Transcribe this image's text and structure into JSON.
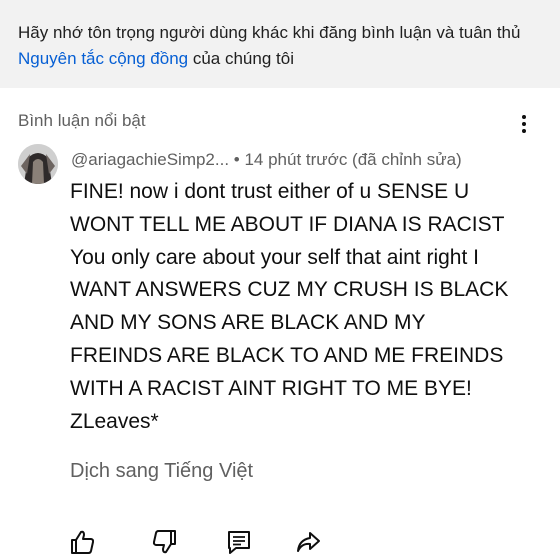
{
  "notice": {
    "before": "Hãy nhớ tôn trọng người dùng khác khi đăng bình luận và tuân thủ ",
    "link": "Nguyên tắc cộng đồng",
    "after": " của chúng tôi"
  },
  "section": {
    "title": "Bình luận nổi bật"
  },
  "comment": {
    "author": "@ariagachieSimp2...",
    "meta": " • 14 phút trước (đã chỉnh sửa)",
    "lines": [
      "FINE! now i dont trust either of u SENSE U",
      "WONT TELL ME ABOUT IF DIANA IS RACIST",
      "You only care about your self that aint right I",
      "WANT ANSWERS CUZ MY CRUSH IS BLACK",
      "AND MY SONS ARE BLACK AND MY",
      "FREINDS ARE BLACK TO  AND ME FREINDS",
      "WITH A RACIST AINT RIGHT TO ME BYE!",
      "ZLeaves*"
    ],
    "translate": "Dịch sang Tiếng Việt"
  },
  "icons": [
    "like-icon",
    "dislike-icon",
    "reply-icon",
    "share-icon"
  ],
  "colors": {
    "link": "#065fd4",
    "secondary_text": "#606060",
    "notice_bg": "#f2f2f2"
  }
}
